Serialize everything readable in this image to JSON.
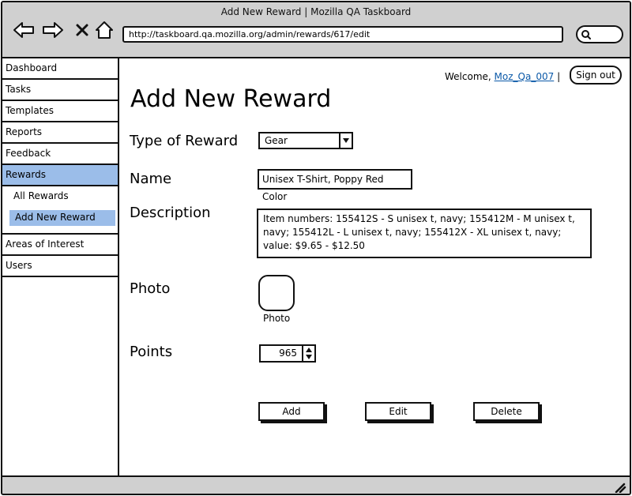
{
  "window": {
    "title": "Add New Reward | Mozilla QA Taskboard"
  },
  "browser": {
    "url": "http://taskboard.qa.mozilla.org/admin/rewards/617/edit",
    "icons": [
      "back-icon",
      "forward-icon",
      "stop-icon",
      "home-icon",
      "search-icon"
    ]
  },
  "sidebar": {
    "items": [
      {
        "label": "Dashboard"
      },
      {
        "label": "Tasks"
      },
      {
        "label": "Templates"
      },
      {
        "label": "Reports"
      },
      {
        "label": "Feedback"
      },
      {
        "label": "Rewards"
      },
      {
        "label": "Areas of Interest"
      },
      {
        "label": "Users"
      }
    ],
    "subitems": [
      {
        "label": "All Rewards"
      },
      {
        "label": "Add New Reward"
      }
    ],
    "active_color": "#9bbde9"
  },
  "header": {
    "welcome_prefix": "Welcome,",
    "username": "Moz_Qa_007",
    "separator": "|",
    "signout_label": "Sign out"
  },
  "form": {
    "page_title": "Add New Reward",
    "type_label": "Type of Reward",
    "type_value": "Gear",
    "name_label": "Name",
    "name_value": "Unisex T-Shirt, Poppy Red Color",
    "description_label": "Description",
    "description_value": "Item numbers: 155412S - S unisex t, navy; 155412M - M unisex t, navy; 155412L - L unisex t, navy; 155412X - XL unisex t, navy; value: $9.65 - $12.50",
    "photo_label": "Photo",
    "photo_caption": "Photo",
    "points_label": "Points",
    "points_value": "965"
  },
  "actions": {
    "add_label": "Add",
    "edit_label": "Edit",
    "delete_label": "Delete"
  }
}
